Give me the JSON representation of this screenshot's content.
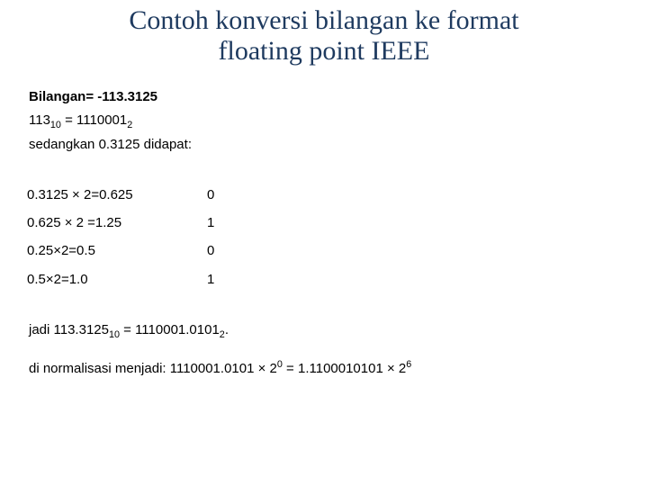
{
  "title_line1": "Contoh konversi bilangan ke format",
  "title_line2": "floating point IEEE",
  "bilangan_label": "Bilangan= -113.3125",
  "int_conv": {
    "dec": "113",
    "dec_sub": "10",
    "eq": " = ",
    "bin": "1110001",
    "bin_sub": "2"
  },
  "sedangkan": "sedangkan 0.3125 didapat:",
  "steps": [
    {
      "calc": "0.3125 × 2=0.625",
      "bit": "0"
    },
    {
      "calc": "0.625 × 2 =1.25",
      "bit": "1"
    },
    {
      "calc": "0.25×2=0.5",
      "bit": "0"
    },
    {
      "calc": "0.5×2=1.0",
      "bit": "1"
    }
  ],
  "jadi": {
    "prefix": "jadi  113.3125",
    "sub1": "10",
    "mid": " = 1110001.0101",
    "sub2": "2",
    "suffix": "."
  },
  "norm": {
    "prefix": "di normalisasi menjadi: 1110001.0101 × 2",
    "exp1": "0",
    "mid": " = 1.1100010101 × 2",
    "exp2": "6"
  }
}
